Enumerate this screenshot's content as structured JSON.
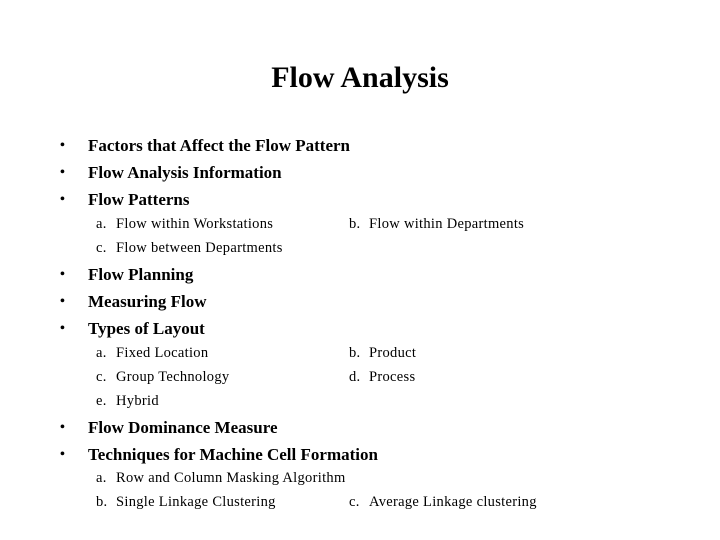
{
  "slide": {
    "title": "Flow Analysis",
    "bullet_symbol": "•",
    "sections": [
      {
        "bullets": [
          "Factors that Affect the Flow Pattern",
          "Flow Analysis Information",
          "Flow Patterns"
        ],
        "subitems": [
          {
            "marker": "a.",
            "text": "Flow within Workstations"
          },
          {
            "marker": "b.",
            "text": "Flow within Departments"
          },
          {
            "marker": "c.",
            "text": "Flow between Departments"
          }
        ]
      },
      {
        "bullets": [
          "Flow Planning",
          "Measuring Flow",
          "Types of Layout"
        ],
        "subitems": [
          {
            "marker": "a.",
            "text": "Fixed Location"
          },
          {
            "marker": "b.",
            "text": "Product"
          },
          {
            "marker": "c.",
            "text": "Group Technology"
          },
          {
            "marker": "d.",
            "text": "Process"
          },
          {
            "marker": "e.",
            "text": "Hybrid"
          }
        ]
      },
      {
        "bullets": [
          "Flow Dominance Measure",
          "Techniques for Machine Cell Formation"
        ],
        "subitems": [
          {
            "marker": "a.",
            "text": "Row and Column Masking Algorithm"
          },
          {
            "marker": "b.",
            "text": "Single Linkage Clustering"
          },
          {
            "marker": "c.",
            "text": "Average Linkage clustering"
          }
        ]
      }
    ]
  }
}
